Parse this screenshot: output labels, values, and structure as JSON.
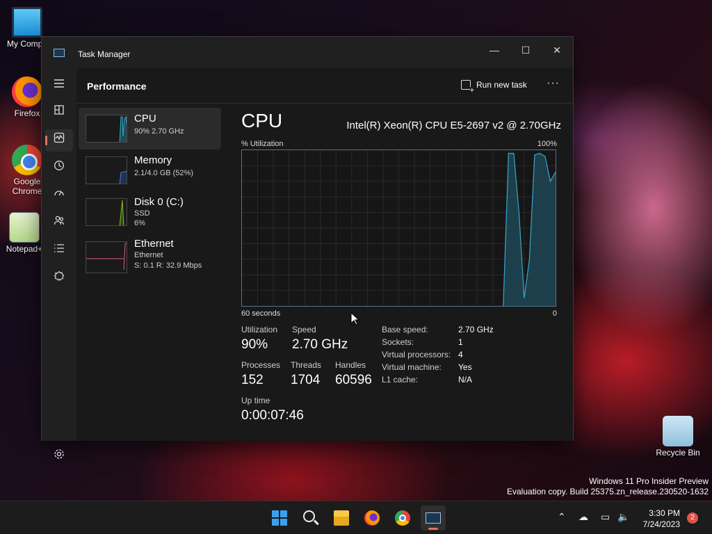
{
  "desktop": {
    "icons": [
      {
        "label": "My Compu",
        "icon": "computer-icon"
      },
      {
        "label": "Firefox",
        "icon": "firefox-icon"
      },
      {
        "label": "Google Chrome",
        "icon": "chrome-icon"
      },
      {
        "label": "Notepad+",
        "icon": "notepad-plus-icon"
      },
      {
        "label": "Recycle Bin",
        "icon": "recycle-bin-icon"
      }
    ],
    "watermark": {
      "line1": "Windows 11 Pro Insider Preview",
      "line2": "Evaluation copy. Build 25375.zn_release.230520-1632"
    }
  },
  "window": {
    "title": "Task Manager",
    "controls": {
      "minimize": "—",
      "maximize": "☐",
      "close": "✕"
    }
  },
  "commandbar": {
    "page_title": "Performance",
    "run_new_task": "Run new task",
    "more": "···"
  },
  "resources": [
    {
      "name": "CPU",
      "line1": "90%  2.70 GHz",
      "line2": "",
      "color": "#3aa7c9",
      "selected": true
    },
    {
      "name": "Memory",
      "line1": "2.1/4.0 GB (52%)",
      "line2": "",
      "color": "#4a7fd0",
      "selected": false
    },
    {
      "name": "Disk 0 (C:)",
      "line1": "SSD",
      "line2": "6%",
      "color": "#8ab930",
      "selected": false
    },
    {
      "name": "Ethernet",
      "line1": "Ethernet",
      "line2": "S: 0.1  R: 32.9 Mbps",
      "color": "#e05a8a",
      "selected": false
    }
  ],
  "cpu": {
    "heading": "CPU",
    "model": "Intel(R) Xeon(R) CPU E5-2697 v2 @ 2.70GHz",
    "util_label": "% Utilization",
    "util_max": "100%",
    "time_left": "60 seconds",
    "time_right": "0",
    "graph_color": "#3aa7c9",
    "graph_history_percent": [
      0,
      0,
      0,
      0,
      0,
      0,
      0,
      0,
      0,
      0,
      0,
      0,
      0,
      0,
      0,
      0,
      0,
      0,
      0,
      0,
      0,
      0,
      0,
      0,
      0,
      0,
      0,
      0,
      0,
      0,
      0,
      0,
      0,
      0,
      0,
      0,
      0,
      0,
      0,
      0,
      0,
      0,
      0,
      0,
      0,
      0,
      0,
      0,
      0,
      0,
      0,
      98,
      98,
      60,
      5,
      30,
      97,
      98,
      96,
      80,
      86
    ],
    "stats": {
      "utilization_label": "Utilization",
      "utilization": "90%",
      "speed_label": "Speed",
      "speed": "2.70 GHz",
      "processes_label": "Processes",
      "processes": "152",
      "threads_label": "Threads",
      "threads": "1704",
      "handles_label": "Handles",
      "handles": "60596",
      "uptime_label": "Up time",
      "uptime": "0:00:07:46"
    },
    "details": [
      {
        "label": "Base speed:",
        "value": "2.70 GHz"
      },
      {
        "label": "Sockets:",
        "value": "1"
      },
      {
        "label": "Virtual processors:",
        "value": "4"
      },
      {
        "label": "Virtual machine:",
        "value": "Yes"
      },
      {
        "label": "L1 cache:",
        "value": "N/A"
      }
    ]
  },
  "nav": [
    "hamburger-icon",
    "processes-icon",
    "performance-icon",
    "app-history-icon",
    "startup-apps-icon",
    "users-icon",
    "details-icon",
    "services-icon",
    "settings-icon"
  ],
  "taskbar": {
    "apps": [
      "start",
      "search",
      "file-explorer",
      "firefox",
      "chrome",
      "task-manager"
    ],
    "clock_time": "3:30 PM",
    "clock_date": "7/24/2023",
    "notifications": "2"
  }
}
